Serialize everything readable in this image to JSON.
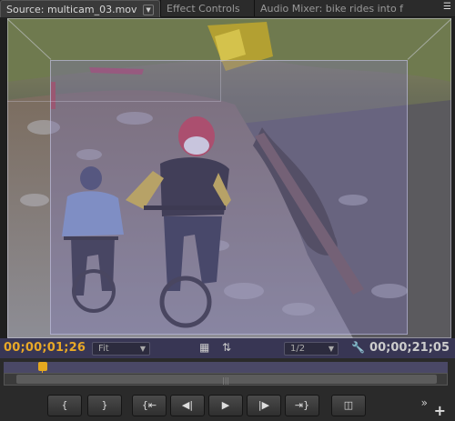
{
  "tabs": [
    {
      "label": "Source: multicam_03.mov",
      "active": true
    },
    {
      "label": "Effect Controls",
      "active": false
    },
    {
      "label": "Audio Mixer: bike rides into f",
      "active": false
    }
  ],
  "viewer": {
    "timecode_current": "00;00;01;26",
    "timecode_duration": "00;00;21;05",
    "zoom_select": "Fit",
    "resolution_select": "1/2"
  },
  "transport": {
    "buttons": [
      "mark-in",
      "mark-out",
      "go-to-in",
      "step-back",
      "play",
      "step-forward",
      "go-to-out",
      "insert-overwrite"
    ]
  },
  "colors": {
    "timecode_accent": "#e9a927",
    "control_bar": "#383654"
  }
}
